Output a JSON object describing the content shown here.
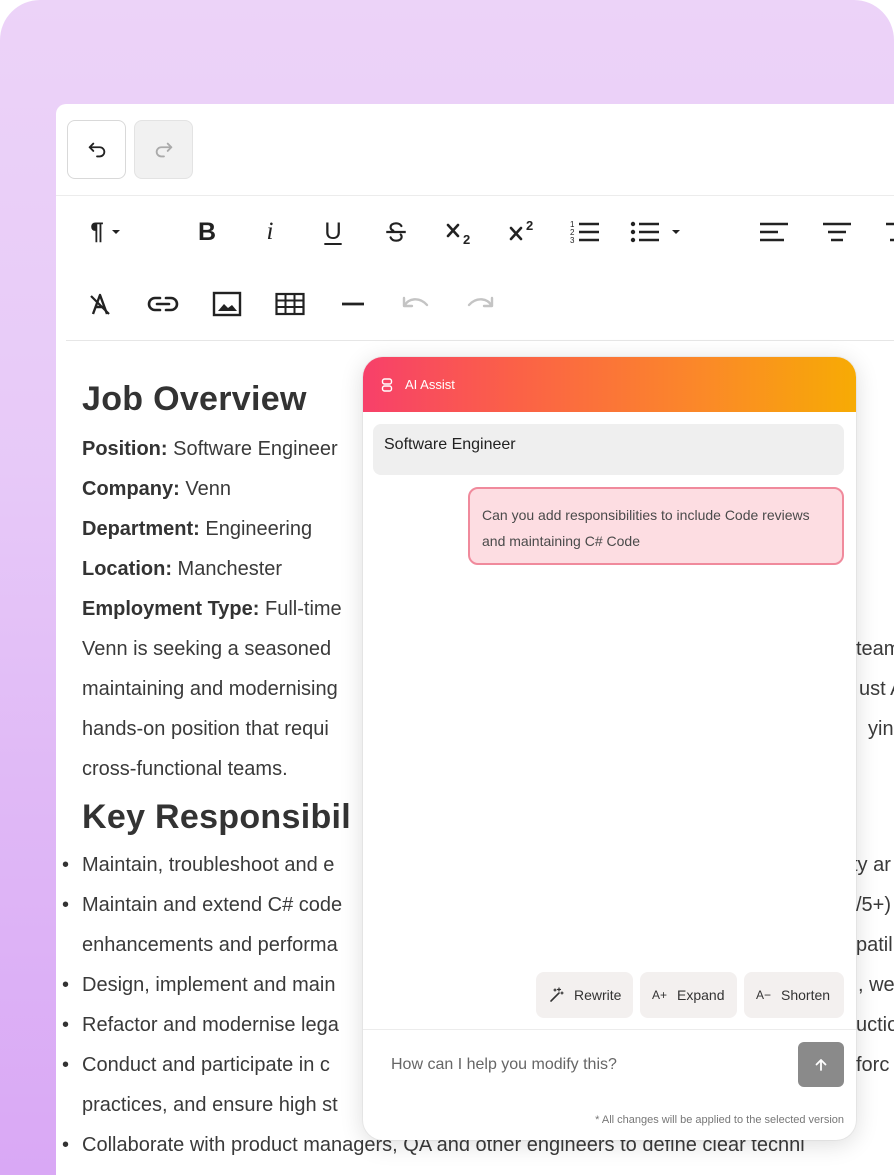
{
  "history": {
    "undo_icon": "undo-icon",
    "redo_icon": "redo-icon"
  },
  "toolbar": {
    "items": [
      "paragraph-icon",
      "bold-icon",
      "italic-icon",
      "underline-icon",
      "strikethrough-icon",
      "subscript-icon",
      "superscript-icon",
      "ordered-list-icon",
      "unordered-list-icon",
      "align-left-icon",
      "align-center-icon",
      "clear-format-icon",
      "link-icon",
      "image-icon",
      "table-icon",
      "horizontal-rule-icon",
      "undo-icon",
      "redo-icon"
    ],
    "bold": "B",
    "italic": "i",
    "underline": "U",
    "paragraph": "¶"
  },
  "document": {
    "heading1": "Job Overview",
    "fields": [
      {
        "label": "Position:",
        "value": " Software Engineer"
      },
      {
        "label": "Company:",
        "value": " Venn"
      },
      {
        "label": "Department:",
        "value": " Engineering"
      },
      {
        "label": "Location:",
        "value": " Manchester"
      },
      {
        "label": "Employment Type:",
        "value": " Full-time"
      }
    ],
    "para": [
      "Venn is seeking a seasoned",
      "maintaining and modernising",
      "hands-on position that requi",
      "cross-functional teams."
    ],
    "para_right": [
      "team",
      "ust A",
      "ying",
      ""
    ],
    "heading2": "Key Responsibil",
    "bullets": [
      {
        "text": "Maintain, troubleshoot and e",
        "right": "ty ar"
      },
      {
        "text": "Maintain and extend C# code",
        "right": "/5+)"
      },
      {
        "text": "enhancements and performa",
        "right": "patil"
      },
      {
        "text": "Design, implement and main",
        "right": ", we"
      },
      {
        "text": "Refactor and modernise lega",
        "right": "uctio"
      },
      {
        "text": "Conduct and participate in c",
        "right": "forc"
      },
      {
        "text": "practices, and ensure high st",
        "right": ""
      },
      {
        "text": "Collaborate with product managers, QA and other engineers to define clear techni",
        "right": ""
      }
    ]
  },
  "assist": {
    "title": "AI Assist",
    "context": "Software Engineer",
    "message": "Can you add responsibilities to include Code reviews and maintaining C# Code",
    "actions": [
      {
        "label": "Rewrite",
        "icon": "magic-wand-icon"
      },
      {
        "label": "Expand",
        "icon": "A+"
      },
      {
        "label": "Shorten",
        "icon": "A−"
      }
    ],
    "input_placeholder": "How can I help you modify this?",
    "footnote": "* All changes will be applied to the selected version"
  }
}
